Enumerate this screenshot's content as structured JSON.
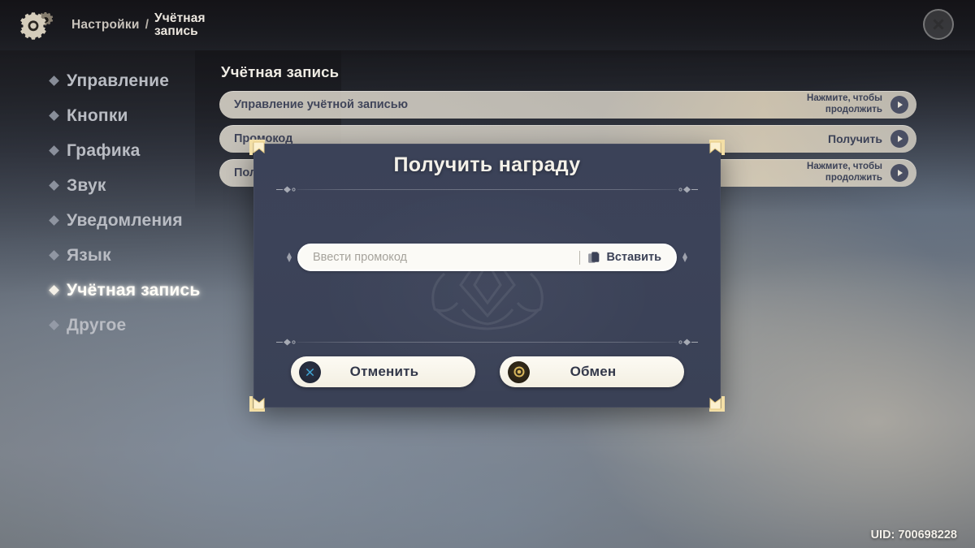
{
  "header": {
    "gear_icon": "gears-icon",
    "breadcrumb_root": "Настройки",
    "breadcrumb_separator": "/",
    "breadcrumb_leaf": "Учётная запись",
    "close_icon": "close-icon"
  },
  "sidebar": {
    "items": [
      {
        "label": "Управление",
        "active": false
      },
      {
        "label": "Кнопки",
        "active": false
      },
      {
        "label": "Графика",
        "active": false
      },
      {
        "label": "Звук",
        "active": false
      },
      {
        "label": "Уведомления",
        "active": false
      },
      {
        "label": "Язык",
        "active": false
      },
      {
        "label": "Учётная запись",
        "active": true
      },
      {
        "label": "Другое",
        "active": false
      }
    ]
  },
  "content": {
    "title": "Учётная запись",
    "rows": [
      {
        "label": "Управление учётной записью",
        "action": "Нажмите, чтобы продолжить",
        "one_line": false
      },
      {
        "label": "Промокод",
        "action": "Получить",
        "one_line": true
      },
      {
        "label": "Получить награду",
        "action": "Нажмите, чтобы продолжить",
        "one_line": false
      }
    ]
  },
  "dialog": {
    "title": "Получить награду",
    "input_placeholder": "Ввести промокод",
    "input_value": "",
    "paste_label": "Вставить",
    "paste_icon": "paste-icon",
    "cancel_label": "Отменить",
    "cancel_icon": "circle-x-icon",
    "exchange_label": "Обмен",
    "exchange_icon": "circle-dot-icon"
  },
  "footer": {
    "uid": "UID: 700698228"
  },
  "colors": {
    "dialog_bg": "#3c4359",
    "pill_bg": "#d8d3c6",
    "accent_gold": "#f5dfa0",
    "text_dark": "#3c4257",
    "text_light": "#f3efe6",
    "active_item": "#fffdf7"
  }
}
